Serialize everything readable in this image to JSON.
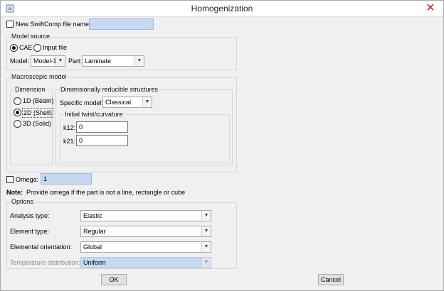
{
  "window": {
    "title": "Homogenization",
    "close_symbol": "✕"
  },
  "swiftcomp": {
    "checkbox_label": "New SwiftComp file name:",
    "file_name": ""
  },
  "model_source": {
    "title": "Model source",
    "options": [
      "CAE",
      "Input file"
    ],
    "selected": "CAE",
    "model_label": "Model:",
    "model_value": "Model-1",
    "part_label": "Part:",
    "part_value": "Laminate"
  },
  "macroscopic": {
    "title": "Macroscopic model",
    "dimension": {
      "title": "Dimension",
      "options": [
        "1D (Beam)",
        "2D (Shell)",
        "3D (Solid)"
      ],
      "selected": "2D (Shell)"
    },
    "reducible": {
      "title": "Dimensionally reducible structures",
      "specific_label": "Specific model:",
      "specific_value": "Classical",
      "twist": {
        "title": "Initial twist/curvature",
        "k12_label": "k12:",
        "k12_value": "0",
        "k21_label": "k21:",
        "k21_value": "0"
      }
    }
  },
  "omega": {
    "label": "Omega:",
    "value": "1"
  },
  "note": {
    "prefix": "Note:",
    "text": "Provide omega if the part is not a line, rectangle or cube"
  },
  "options": {
    "title": "Options",
    "analysis_label": "Analysis type:",
    "analysis_value": "Elastic",
    "element_label": "Element type:",
    "element_value": "Regular",
    "orientation_label": "Elemental orientation:",
    "orientation_value": "Global",
    "temperature_label": "Temperature distribution:",
    "temperature_value": "Uniform"
  },
  "buttons": {
    "ok": "OK",
    "cancel": "Cancel"
  },
  "colors": {
    "field_highlight": "#c6d9f1",
    "close_red": "#c42b1c"
  },
  "icons": {
    "app": "app-icon",
    "close": "close-icon",
    "dropdown": "chevron-down-icon"
  }
}
